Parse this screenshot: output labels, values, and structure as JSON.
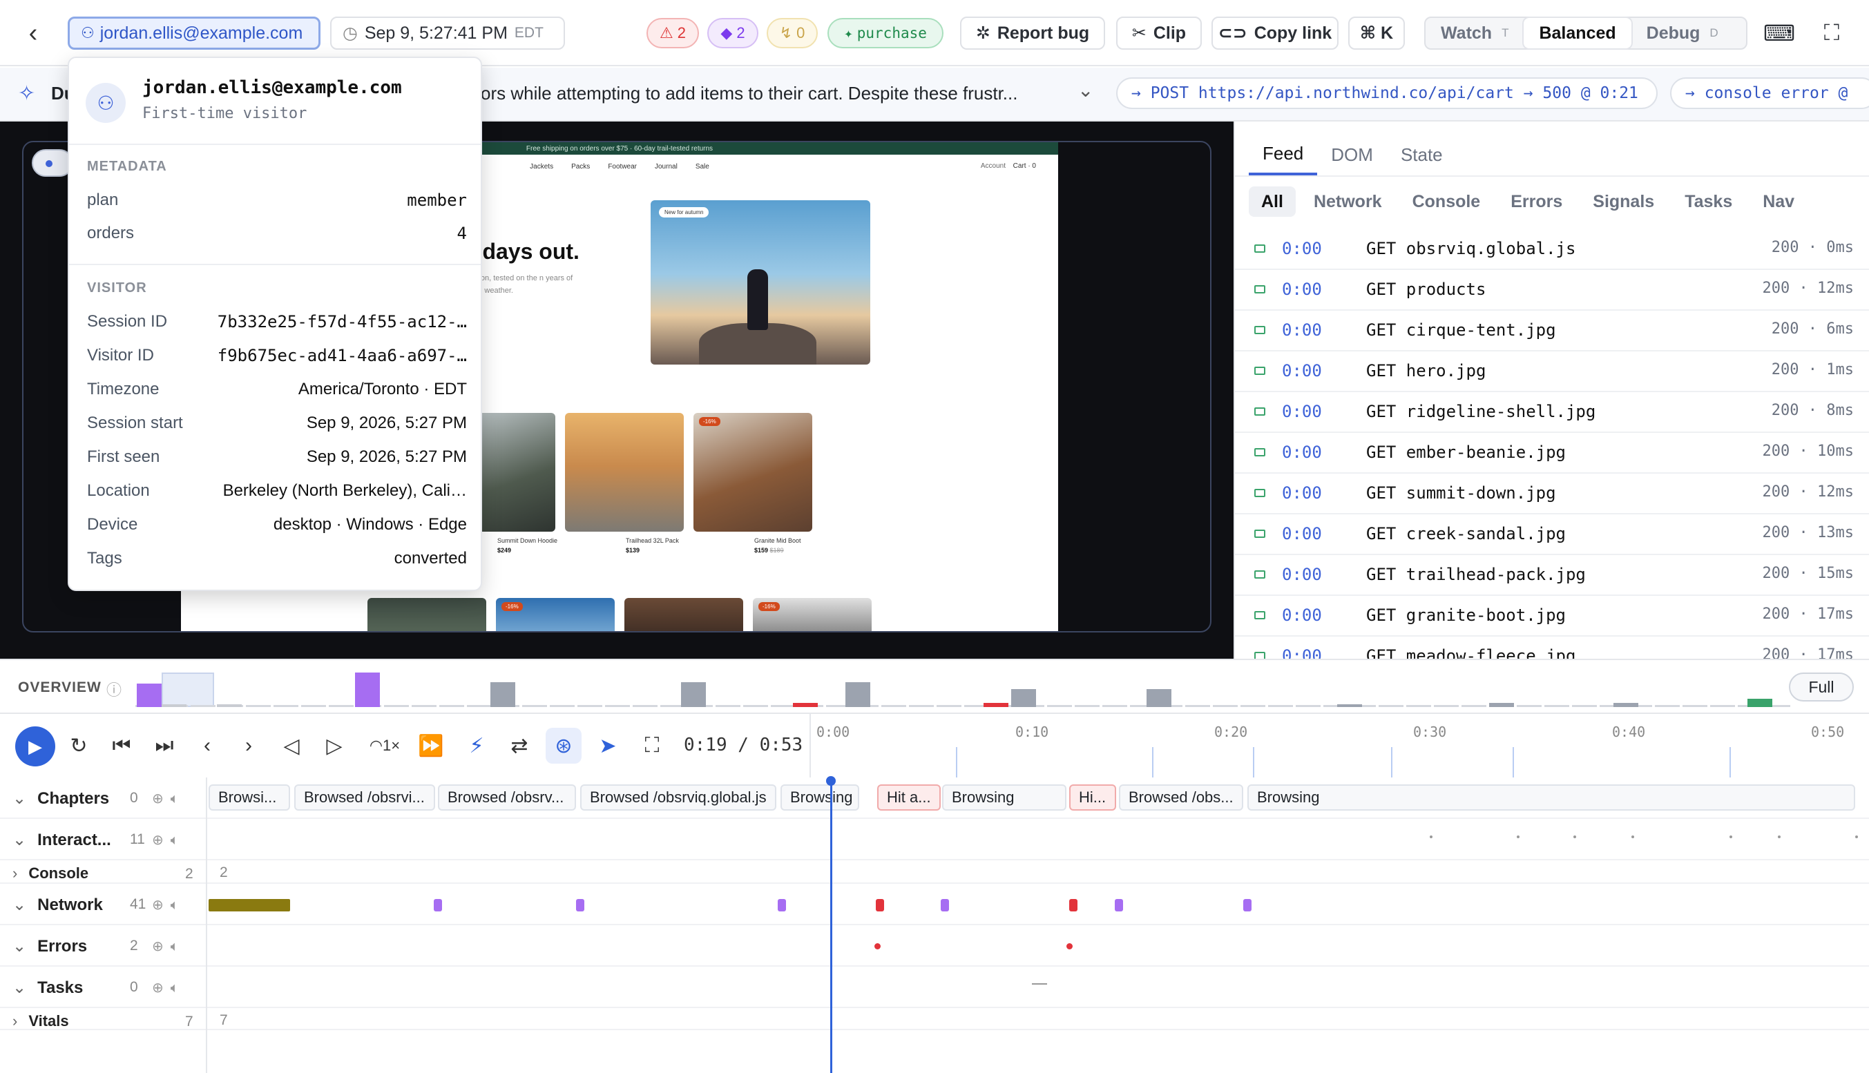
{
  "topbar": {
    "back_icon": "chevron-left-icon",
    "user_email": "jordan.ellis@example.com",
    "session_time": "Sep 9, 5:27:41 PM",
    "session_tz": "EDT",
    "errors_count": "2",
    "signals_count": "2",
    "tasks_count": "0",
    "goal_label": "purchase",
    "report_bug": "Report bug",
    "clip": "Clip",
    "copy_link": "Copy link",
    "shortcut": "⌘ K",
    "modes": [
      {
        "label": "Watch",
        "key": "T"
      },
      {
        "label": "Balanced",
        "key": ""
      },
      {
        "label": "Debug",
        "key": "D"
      }
    ]
  },
  "summary": {
    "label": "Du",
    "text": "ors while attempting to add items to their cart. Despite these frustr...",
    "events": [
      "→ POST https://api.northwind.co/api/cart → 500 @ 0:21",
      "→ console error @"
    ]
  },
  "site": {
    "promo": "Free shipping on orders over $75 · 60-day trail-tested returns",
    "nav": [
      "Jackets",
      "Packs",
      "Footwear",
      "Journal",
      "Sale"
    ],
    "account": "Account",
    "cart": "Cart · 0",
    "hero_title": "g days out.",
    "hero_sub": "regon, tested on the\nn years of bad weather.",
    "hero_badge": "New for autumn",
    "products": [
      {
        "name": "Summit Down Hoodie",
        "price": "$249",
        "was": ""
      },
      {
        "name": "Trailhead 32L Pack",
        "price": "$139",
        "was": ""
      },
      {
        "name": "Granite Mid Boot",
        "price": "$159",
        "was": "$189"
      }
    ],
    "sale_badge": "-16%"
  },
  "panel": {
    "tabs": [
      "Feed",
      "DOM",
      "State"
    ],
    "filters": [
      "All",
      "Network",
      "Console",
      "Errors",
      "Signals",
      "Tasks",
      "Nav"
    ],
    "feed": [
      {
        "time": "0:00",
        "req": "GET obsrviq.global.js",
        "status": "200 · 0ms"
      },
      {
        "time": "0:00",
        "req": "GET products",
        "status": "200 · 12ms"
      },
      {
        "time": "0:00",
        "req": "GET cirque-tent.jpg",
        "status": "200 · 6ms"
      },
      {
        "time": "0:00",
        "req": "GET hero.jpg",
        "status": "200 · 1ms"
      },
      {
        "time": "0:00",
        "req": "GET ridgeline-shell.jpg",
        "status": "200 · 8ms"
      },
      {
        "time": "0:00",
        "req": "GET ember-beanie.jpg",
        "status": "200 · 10ms"
      },
      {
        "time": "0:00",
        "req": "GET summit-down.jpg",
        "status": "200 · 12ms"
      },
      {
        "time": "0:00",
        "req": "GET creek-sandal.jpg",
        "status": "200 · 13ms"
      },
      {
        "time": "0:00",
        "req": "GET trailhead-pack.jpg",
        "status": "200 · 15ms"
      },
      {
        "time": "0:00",
        "req": "GET granite-boot.jpg",
        "status": "200 · 17ms"
      },
      {
        "time": "0:00",
        "req": "GET meadow-fleece.jpg",
        "status": "200 · 17ms"
      }
    ]
  },
  "popover": {
    "email": "jordan.ellis@example.com",
    "subtitle": "First-time visitor",
    "metadata_heading": "METADATA",
    "metadata": [
      {
        "k": "plan",
        "v": "member"
      },
      {
        "k": "orders",
        "v": "4"
      }
    ],
    "visitor_heading": "VISITOR",
    "visitor": [
      {
        "k": "Session ID",
        "v": "7b332e25-f57d-4f55-ac12-…"
      },
      {
        "k": "Visitor ID",
        "v": "f9b675ec-ad41-4aa6-a697-…"
      },
      {
        "k": "Timezone",
        "v": "America/Toronto · EDT"
      },
      {
        "k": "Session start",
        "v": "Sep 9, 2026, 5:27 PM"
      },
      {
        "k": "First seen",
        "v": "Sep 9, 2026, 5:27 PM"
      },
      {
        "k": "Location",
        "v": "Berkeley (North Berkeley), Cali…"
      },
      {
        "k": "Device",
        "v": "desktop · Windows · Edge"
      },
      {
        "k": "Tags",
        "v": "converted"
      }
    ]
  },
  "overview": {
    "label": "OVERVIEW",
    "full": "Full"
  },
  "controls": {
    "speed": "1×",
    "current": "0:19",
    "total": "0:53",
    "ticks": [
      "0:00",
      "0:10",
      "0:20",
      "0:30",
      "0:40",
      "0:50"
    ]
  },
  "tracks": [
    {
      "label": "Chapters",
      "count": "0",
      "expanded": true
    },
    {
      "label": "Interact...",
      "count": "11",
      "expanded": true
    },
    {
      "label": "Console",
      "count": "2",
      "expanded": false,
      "inline": "2"
    },
    {
      "label": "Network",
      "count": "41",
      "expanded": true
    },
    {
      "label": "Errors",
      "count": "2",
      "expanded": true
    },
    {
      "label": "Tasks",
      "count": "0",
      "expanded": true
    },
    {
      "label": "Vitals",
      "count": "7",
      "expanded": false,
      "inline": "7"
    }
  ],
  "chapters": [
    {
      "label": "Browsi...",
      "err": false
    },
    {
      "label": "Browsed /obsrvi...",
      "err": false
    },
    {
      "label": "Browsed /obsrv...",
      "err": false
    },
    {
      "label": "Browsed /obsrviq.global.js",
      "err": false
    },
    {
      "label": "Browsing",
      "err": false
    },
    {
      "label": "Hit a...",
      "err": true
    },
    {
      "label": "Browsing",
      "err": false
    },
    {
      "label": "Hi...",
      "err": true
    },
    {
      "label": "Browsed /obs...",
      "err": false
    },
    {
      "label": "Browsing",
      "err": false
    }
  ]
}
